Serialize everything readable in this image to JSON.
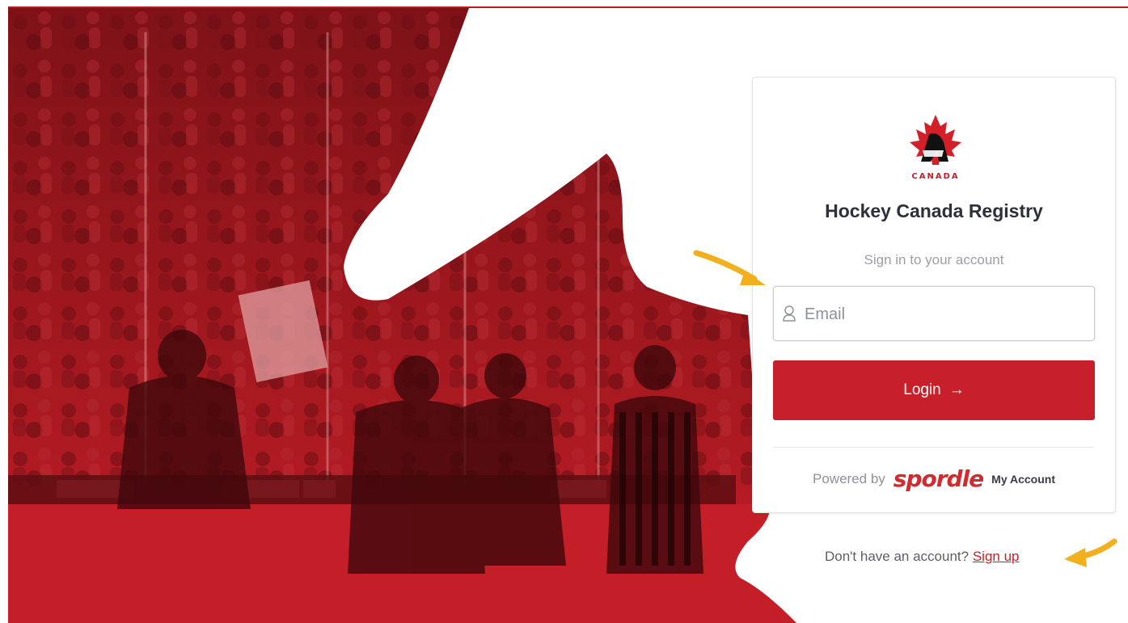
{
  "brand": {
    "logo_text": "CANADA",
    "title": "Hockey Canada Registry",
    "subtitle": "Sign in to your account"
  },
  "form": {
    "email_placeholder": "Email",
    "login_label": "Login",
    "login_arrow": "→"
  },
  "footer": {
    "powered_by": "Powered by",
    "product_name": "spordle",
    "product_suffix": "My Account"
  },
  "signup": {
    "prompt": "Don't have an account?",
    "link_label": "Sign up"
  },
  "colors": {
    "brand_red": "#c8202a",
    "hero_red": "#9e1a20",
    "annotation_arrow": "#f2b01e"
  },
  "icons": {
    "email_field": "user-icon",
    "login_button": "arrow-right-icon",
    "annotations": "annotation-arrow-icon"
  }
}
